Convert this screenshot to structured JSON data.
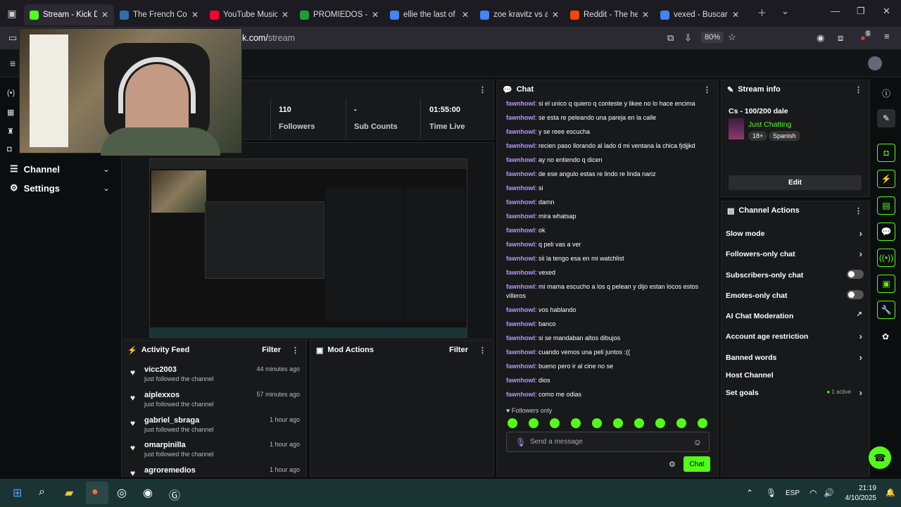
{
  "browser": {
    "tabs": [
      {
        "title": "Stream - Kick Dash",
        "color": "#53fc18",
        "active": true
      },
      {
        "title": "The French Connect",
        "color": "#2f6fb0",
        "active": false
      },
      {
        "title": "YouTube Music",
        "color": "#ff0033",
        "active": false
      },
      {
        "title": "PROMIEDOS - Fut",
        "color": "#1e9e3a",
        "active": false
      },
      {
        "title": "ellie the last of us",
        "color": "#4285f4",
        "active": false
      },
      {
        "title": "zoe kravitz vs ann",
        "color": "#4285f4",
        "active": false
      },
      {
        "title": "Reddit - The heart",
        "color": "#ff4500",
        "active": false
      },
      {
        "title": "vexed - Buscar con",
        "color": "#4285f4",
        "active": false
      }
    ],
    "url_main": "k.com/",
    "url_path": "stream",
    "zoom": "80%",
    "ext_badge": "5"
  },
  "sidenav": {
    "channel": "Channel",
    "settings": "Settings"
  },
  "stats": [
    {
      "value": "110",
      "label": "Followers"
    },
    {
      "value": "-",
      "label": "Sub Counts"
    },
    {
      "value": "01:55:00",
      "label": "Time Live"
    }
  ],
  "activity": {
    "title": "Activity Feed",
    "filter": "Filter",
    "items": [
      {
        "name": "vicc2003",
        "sub": "just followed the channel",
        "time": "44 minutes ago"
      },
      {
        "name": "aiplexxos",
        "sub": "just followed the channel",
        "time": "57 minutes ago"
      },
      {
        "name": "gabriel_sbraga",
        "sub": "just followed the channel",
        "time": "1 hour ago"
      },
      {
        "name": "omarpinilla",
        "sub": "just followed the channel",
        "time": "1 hour ago"
      },
      {
        "name": "agroremedios",
        "sub": "",
        "time": "1 hour ago"
      }
    ]
  },
  "mod": {
    "title": "Mod Actions",
    "filter": "Filter"
  },
  "chat": {
    "title": "Chat",
    "user": "fawnhowl",
    "messages": [
      "si el unico q quiero q conteste y likee no lo hace encima",
      "se esta re peleando una pareja en la calle",
      "y se reee escucha",
      "recien paso llorando al lado d mi ventana la chica fjdjjkd",
      "ay no entiendo q dicen",
      "de ese angulo estas re lindo re linda nariz",
      "si",
      "damn",
      "mira whatsap",
      "ok",
      "q peli vas a ver",
      "sii la tengo esa en mi watchlist",
      "vexed",
      "mi mama escucho a los q pelean y dijo estan locos estos villeros",
      "vos hablando",
      "banco",
      "si se mandaban altos dibujos",
      "cuando vemos una peli juntos :((",
      "bueno pero ir al cine no se",
      "dios",
      "como me odias"
    ],
    "followers_only": "Followers only",
    "placeholder": "Send a message",
    "send": "Chat"
  },
  "stream_info": {
    "title": "Stream info",
    "stream_title": "Cs - 100/200 dale",
    "category": "Just Chatting",
    "tags": [
      "18+",
      "Spanish"
    ],
    "edit": "Edit"
  },
  "channel_actions": {
    "title": "Channel Actions",
    "items": [
      {
        "label": "Slow mode",
        "control": "chevron"
      },
      {
        "label": "Followers-only chat",
        "control": "chevron"
      },
      {
        "label": "Subscribers-only chat",
        "control": "toggle"
      },
      {
        "label": "Emotes-only chat",
        "control": "toggle"
      },
      {
        "label": "AI Chat Moderation",
        "control": "external"
      },
      {
        "label": "Account age restriction",
        "control": "chevron"
      },
      {
        "label": "Banned words",
        "control": "chevron"
      },
      {
        "label": "Host Channel",
        "control": "none"
      },
      {
        "label": "Set goals",
        "control": "chevron"
      }
    ],
    "goals_status": "1 active"
  },
  "taskbar": {
    "lang": "ESP",
    "time": "21:19",
    "date": "4/10/2025"
  },
  "colors": {
    "brand": "#53fc18",
    "username": "#b795ff"
  }
}
